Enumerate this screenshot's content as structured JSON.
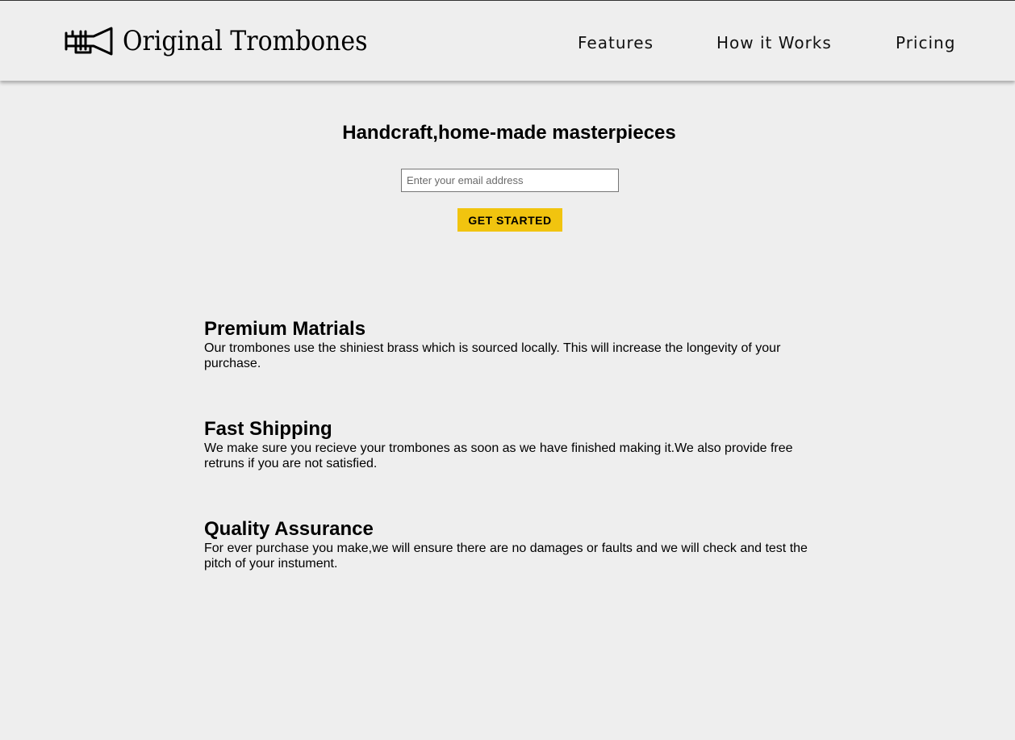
{
  "brand": {
    "name": "Original Trombones",
    "icon": "trumpet-logo-icon"
  },
  "nav": {
    "items": [
      {
        "label": "Features"
      },
      {
        "label": "How it Works"
      },
      {
        "label": "Pricing"
      }
    ]
  },
  "hero": {
    "title": "Handcraft,home-made masterpieces",
    "email_placeholder": "Enter your email address",
    "email_value": "",
    "cta_label": "GET STARTED"
  },
  "features": [
    {
      "title": "Premium Matrials",
      "text": "Our trombones use the shiniest brass which is sourced locally. This will increase the longevity of your purchase."
    },
    {
      "title": "Fast Shipping",
      "text": "We make sure you recieve your trombones as soon as we have finished making it.We also provide free retruns if you are not satisfied."
    },
    {
      "title": "Quality Assurance",
      "text": "For ever purchase you make,we will ensure there are no damages or faults and we will check and test the pitch of your instument."
    }
  ],
  "colors": {
    "background": "#eeeeee",
    "accent": "#f1c40f",
    "text": "#000000"
  }
}
